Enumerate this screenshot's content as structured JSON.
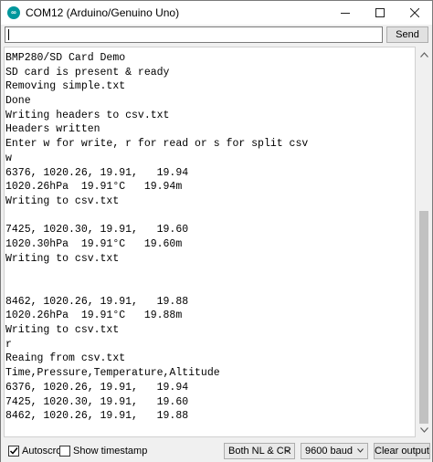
{
  "window": {
    "title": "COM12 (Arduino/Genuino Uno)",
    "controls": {
      "minimize": "—",
      "maximize": "☐",
      "close": "✕"
    }
  },
  "send_bar": {
    "input_value": "",
    "send_label": "Send"
  },
  "serial_output": {
    "lines": [
      "BMP280/SD Card Demo",
      "SD card is present & ready",
      "Removing simple.txt",
      "Done",
      "Writing headers to csv.txt",
      "Headers written",
      "Enter w for write, r for read or s for split csv",
      "w",
      "6376, 1020.26, 19.91,   19.94",
      "1020.26hPa  19.91°C   19.94m",
      "Writing to csv.txt",
      "",
      "7425, 1020.30, 19.91,   19.60",
      "1020.30hPa  19.91°C   19.60m",
      "Writing to csv.txt",
      "",
      "",
      "8462, 1020.26, 19.91,   19.88",
      "1020.26hPa  19.91°C   19.88m",
      "Writing to csv.txt",
      "r",
      "Reaing from csv.txt",
      "Time,Pressure,Temperature,Altitude",
      "6376, 1020.26, 19.91,   19.94",
      "7425, 1020.30, 19.91,   19.60",
      "8462, 1020.26, 19.91,   19.88",
      ""
    ]
  },
  "status_bar": {
    "autoscroll_label": "Autoscroll",
    "autoscroll_checked": true,
    "timestamp_label": "Show timestamp",
    "timestamp_checked": false,
    "line_ending": "Both NL & CR",
    "baud_rate": "9600 baud",
    "clear_label": "Clear output"
  },
  "colors": {
    "arduino_teal": "#00979c",
    "window_bg": "#f0f0f0",
    "output_bg": "#ffffff"
  }
}
